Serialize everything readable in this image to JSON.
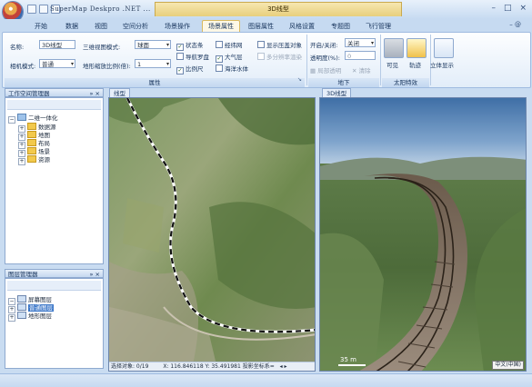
{
  "title": {
    "app_name": "SuperMap Deskpro .NET ...",
    "context_group": "3D线型",
    "window_buttons": [
      "–",
      "□",
      "×"
    ]
  },
  "tabs": [
    "开始",
    "数据",
    "视图",
    "空间分析",
    "场景操作",
    "场景属性",
    "图层属性",
    "风格设置",
    "专题图",
    "飞行管理"
  ],
  "active_tab": "场景属性",
  "ribbon_help": "–  @",
  "ribbon": {
    "name_label": "名称:",
    "name_value": "3D线型",
    "camera_label": "相机模式:",
    "camera_value": "普通",
    "mode_label": "三维视图模式:",
    "mode_value": "球面",
    "scale_label": "地形缩放比例(倍):",
    "scale_value": "1",
    "checks": [
      {
        "label": "状态条",
        "checked": true
      },
      {
        "label": "导航罗盘",
        "checked": false
      },
      {
        "label": "比例尺",
        "checked": true
      },
      {
        "label": "经纬网",
        "checked": false
      },
      {
        "label": "大气层",
        "checked": true
      },
      {
        "label": "海洋水体",
        "checked": false
      },
      {
        "label": "显示压盖对象",
        "checked": false
      },
      {
        "label": "多分辨率渲染",
        "checked": false,
        "disabled": true
      }
    ],
    "group_property": "属性",
    "ground_onoff_label": "开启/关闭:",
    "ground_onoff_value": "关闭",
    "transparency_label": "透明度(%):",
    "transparency_value": "0",
    "local_transparent": "局部透明",
    "clear": "清除",
    "group_ground": "地下",
    "visible_label": "可见",
    "track_label": "轨迹",
    "group_sun": "太阳特效",
    "stereo_label": "立体显示",
    "dialog_launcher": "↘"
  },
  "workspace": {
    "header": "工作空间管理器",
    "pin": "» ×",
    "root": "二维一体化",
    "items": [
      "数据源",
      "地图",
      "布局",
      "场景",
      "资源"
    ]
  },
  "layers": {
    "header": "图层管理器",
    "pin": "» ×",
    "items": [
      "屏幕图层",
      "普通图层",
      "地形图层"
    ]
  },
  "map_view": {
    "tab": "线型",
    "status_left": "选择对象: 0/19",
    "status_coords": "X: 116.846118  Y: 35.491981  投影坐标系=",
    "scroll_arrows": "◂ ▸"
  },
  "scene_view": {
    "tab": "3D线型",
    "scale_text": "35 m",
    "ime": "中文(中国)"
  },
  "colors": {
    "ribbon_bg": "#e2edf9",
    "active_tab": "#fdf8e6",
    "context_tab": "#e8cf7c",
    "highlight": "#3a76c8"
  }
}
